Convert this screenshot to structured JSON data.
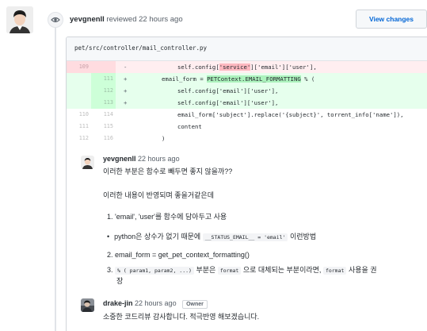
{
  "review": {
    "author": "yevgnenll",
    "action": "reviewed",
    "time": "22 hours ago",
    "view_changes": "View changes"
  },
  "file": {
    "path": "pet/src/controller/mail_controller.py"
  },
  "diff": [
    {
      "type": "del",
      "old": "109",
      "new": "",
      "sign": "-",
      "pre": "self.config[",
      "hl": "'service'",
      "post": "]['email']['user'],"
    },
    {
      "type": "add",
      "old": "",
      "new": "111",
      "sign": "+",
      "pre": "email_form = ",
      "hl": "PETContext.EMAIL_FORMATTING",
      "post": " % ("
    },
    {
      "type": "add",
      "old": "",
      "new": "112",
      "sign": "+",
      "code": "self.config['email']['user'],"
    },
    {
      "type": "add",
      "old": "",
      "new": "113",
      "sign": "+",
      "code": "self.config['email']['user'],"
    },
    {
      "type": "ctx",
      "old": "110",
      "new": "114",
      "sign": "",
      "code": "email_form['subject'].replace('{subject}', torrent_info['name']),"
    },
    {
      "type": "ctx",
      "old": "111",
      "new": "115",
      "sign": "",
      "code": "content"
    },
    {
      "type": "ctx",
      "old": "112",
      "new": "116",
      "sign": "",
      "code": ")"
    }
  ],
  "comments": [
    {
      "author": "yevgnenll",
      "time": "22 hours ago",
      "line1": "이러한 부분은 함수로 빼두면 좋지 않을까??",
      "line2": "이러한 내용이 반영되며 좋을거같은데",
      "item1": "1. 'email', 'user'를 함수에 담아두고 사용",
      "bullet_pre": "python은 상수가 없기 때문에",
      "bullet_code": "__STATUS_EMAIL__ = 'email'",
      "bullet_post": "이런방법",
      "item2": "2. email_form = get_pet_context_formatting()",
      "item3_pre": "3.",
      "item3_code1": "% ( param1, param2, ...)",
      "item3_mid": "부분은",
      "item3_code2": "format",
      "item3_post": "으로 대체되는 부분이라면,",
      "item3_code3": "format",
      "item3_end": "사용을 권",
      "item3_wrap": "장"
    },
    {
      "author": "drake-jin",
      "time": "22 hours ago",
      "badge": "Owner",
      "text": "소중한 코드리뷰 감사합니다. 적극반영 해보겠습니다."
    }
  ],
  "colors": {
    "link": "#0366d6",
    "del_bg": "#ffeef0",
    "add_bg": "#e6ffed",
    "del_hl": "#fdb8c0",
    "add_hl": "#acf2bd"
  },
  "icons": {
    "review_badge": "eye-icon"
  }
}
